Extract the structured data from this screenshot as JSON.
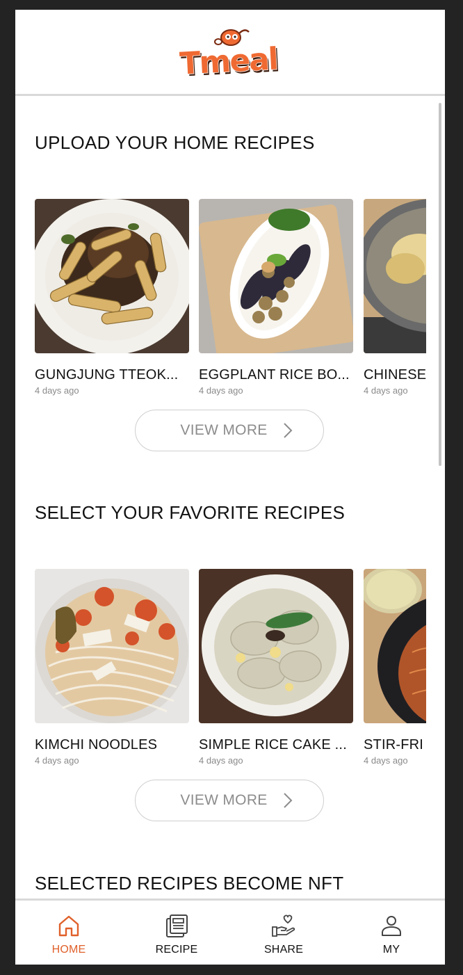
{
  "app": {
    "logo_text": "Tmeal",
    "colors": {
      "accent": "#e0602a",
      "logo_fill": "#ef6a32",
      "text": "#111111",
      "muted": "#8a8a8a"
    }
  },
  "sections": [
    {
      "title": "UPLOAD YOUR HOME RECIPES",
      "cards": [
        {
          "title": "GUNGJUNG TTEOK...",
          "time": "4 days ago",
          "image": "rice-cake-stir-fry-photo"
        },
        {
          "title": "EGGPLANT RICE BO...",
          "time": "4 days ago",
          "image": "eggplant-rice-bowl-photo"
        },
        {
          "title": "CHINESE",
          "time": "4 days ago",
          "image": "chinese-dish-photo"
        }
      ],
      "view_more": "VIEW MORE"
    },
    {
      "title": "SELECT YOUR FAVORITE RECIPES",
      "cards": [
        {
          "title": "KIMCHI NOODLES",
          "time": "4 days ago",
          "image": "kimchi-noodles-photo"
        },
        {
          "title": "SIMPLE RICE CAKE ...",
          "time": "4 days ago",
          "image": "dumpling-soup-photo"
        },
        {
          "title": "STIR-FRI",
          "time": "4 days ago",
          "image": "stir-fried-noodles-photo"
        }
      ],
      "view_more": "VIEW MORE"
    },
    {
      "title": "SELECTED RECIPES BECOME NFT"
    }
  ],
  "bottom_nav": [
    {
      "label": "HOME",
      "icon": "home-icon",
      "active": true
    },
    {
      "label": "RECIPE",
      "icon": "recipe-icon",
      "active": false
    },
    {
      "label": "SHARE",
      "icon": "share-heart-hand-icon",
      "active": false
    },
    {
      "label": "MY",
      "icon": "user-icon",
      "active": false
    }
  ]
}
